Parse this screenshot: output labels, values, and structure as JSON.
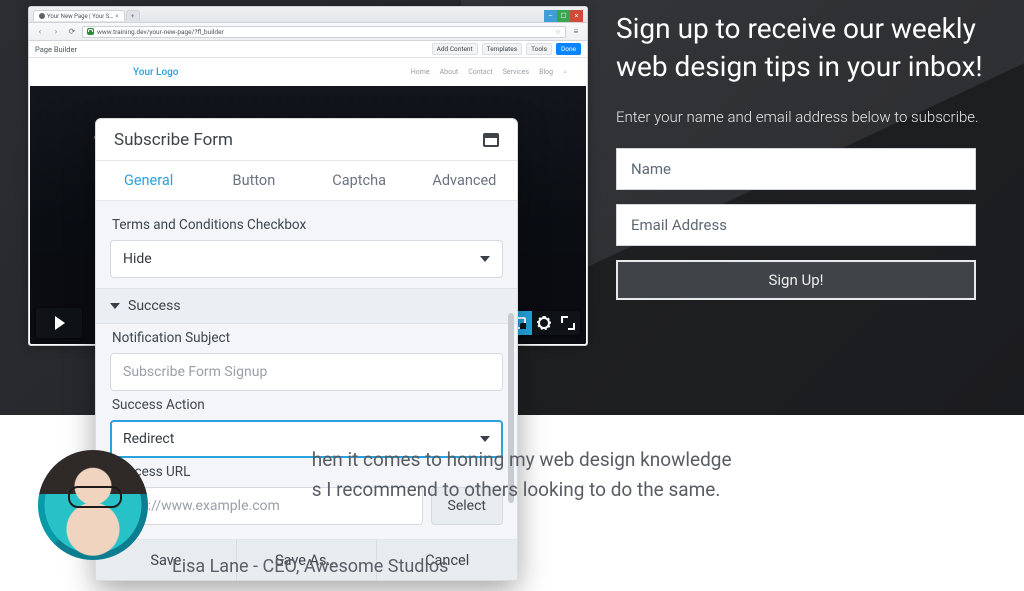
{
  "hero": {
    "heading": "Sign up to receive our weekly web design tips in your inbox!",
    "sub": "Enter your name and email address below to subscribe.",
    "name_placeholder": "Name",
    "email_placeholder": "Email Address",
    "button": "Sign Up!"
  },
  "browser": {
    "tabA": "Your New Page | Your S…",
    "tabB": "",
    "url": "www.training.dev/your-new-page/?fl_builder",
    "page_builder": "Page Builder",
    "actions": {
      "add": "Add Content",
      "templates": "Templates",
      "tools": "Tools",
      "done": "Done"
    },
    "brand": "Your Logo",
    "nav": [
      "Home",
      "About",
      "Contact",
      "Services",
      "Blog"
    ]
  },
  "panel": {
    "title": "Subscribe Form",
    "tabs": {
      "general": "General",
      "button": "Button",
      "captcha": "Captcha",
      "advanced": "Advanced"
    },
    "tac_label": "Terms and Conditions Checkbox",
    "tac_value": "Hide",
    "success_header": "Success",
    "notif_label": "Notification Subject",
    "notif_placeholder": "Subscribe Form Signup",
    "action_label": "Success Action",
    "action_value": "Redirect",
    "url_label": "Success URL",
    "url_placeholder": "http://www.example.com",
    "select_btn": "Select",
    "save": "Save",
    "save_as": "Save As...",
    "cancel": "Cancel"
  },
  "quote": {
    "line": "hen it comes to honing my web design knowledge s I recommend to others looking to do the same.",
    "line1": "hen it comes to honing my web design knowledge",
    "line2": "s I recommend to others looking to do the same.",
    "attr": "Lisa Lane - CEO, Awesome Studios"
  }
}
